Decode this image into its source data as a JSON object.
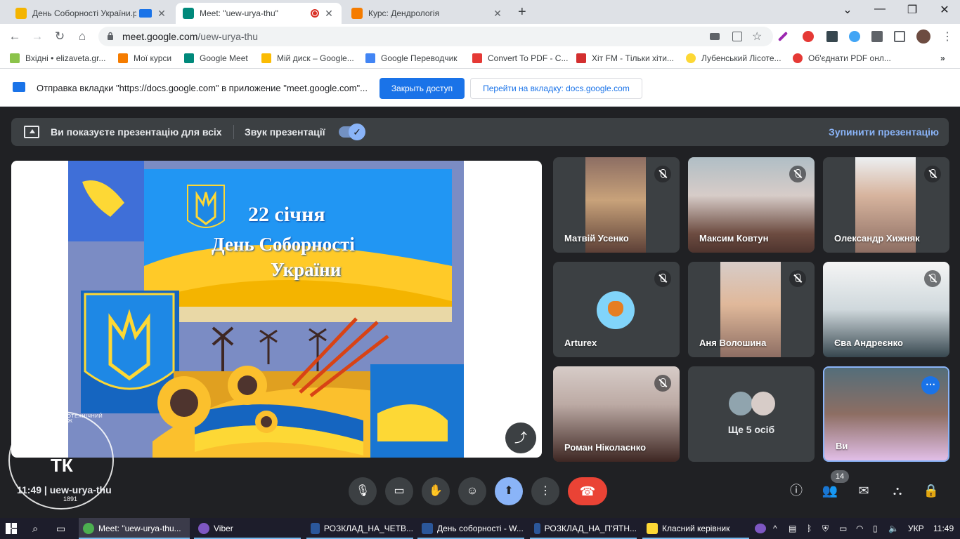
{
  "browser": {
    "tabs": [
      {
        "title": "День Соборності України.р",
        "favicon_color": "#f4b400"
      },
      {
        "title": "Meet: \"uew-urya-thu\"",
        "favicon_color": "#00897b"
      },
      {
        "title": "Курс: Дендрологія",
        "favicon_color": "#f57c00"
      }
    ],
    "url_host": "meet.google.com",
    "url_path": "/uew-urya-thu",
    "bookmarks": [
      "Вхідні • elizaveta.gr...",
      "Мої курси",
      "Google Meet",
      "Мій диск – Google...",
      "Google Переводчик",
      "Convert To PDF - C...",
      "Хіт FM - Тільки хіти...",
      "Лубенський Лісоте...",
      "Об'єднати PDF онл..."
    ],
    "bookmarks_more": "»"
  },
  "infobar": {
    "message": "Отправка вкладки \"https://docs.google.com\" в приложение \"meet.google.com\"...",
    "close_access": "Закрыть доступ",
    "go_to_tab": "Перейти на вкладку: docs.google.com"
  },
  "meet": {
    "presenting_text": "Ви показуєте презентацію для всіх",
    "presentation_sound": "Звук презентації",
    "stop_presenting": "Зупинити презентацію",
    "slide": {
      "line1": "22 січня",
      "line2": "День Соборності",
      "line3": "України"
    },
    "participants": [
      {
        "name": "Матвій Усенко"
      },
      {
        "name": "Максим Ковтун"
      },
      {
        "name": "Олександр Хижняк"
      },
      {
        "name": "Arturex"
      },
      {
        "name": "Аня Волошина"
      },
      {
        "name": "Єва Андреєнко"
      },
      {
        "name": "Роман Ніколаєнко"
      },
      {
        "name": "Ще 5 осіб"
      },
      {
        "name": "Ви"
      }
    ],
    "time": "11:49",
    "meeting_code": "uew-urya-thu",
    "participant_count": "14",
    "watermark": {
      "letters": "ТК",
      "arc_text": "ЛУБЕНСЬКИЙ ЛІСОТЕХНІЧНИЙ КОЛЕДЖ",
      "year": "1891"
    }
  },
  "taskbar": {
    "items": [
      "Meet: \"uew-urya-thu...",
      "Viber",
      "РОЗКЛАД_НА_ЧЕТВ...",
      "День соборності - W...",
      "РОЗКЛАД_НА_П'ЯТН...",
      "Класний керівник"
    ],
    "language": "УКР",
    "time": "11:49"
  }
}
